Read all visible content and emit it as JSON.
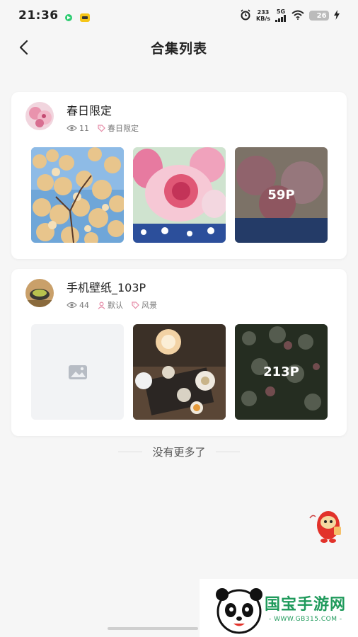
{
  "status_bar": {
    "time": "21:36",
    "net_speed_value": "233",
    "net_speed_unit": "KB/s",
    "network": "5G",
    "battery": "26",
    "battery_level_percent": 26
  },
  "nav": {
    "title": "合集列表"
  },
  "collections": [
    {
      "title": "春日限定",
      "views": "11",
      "tag": "春日限定",
      "more_count": "59P"
    },
    {
      "title": "手机壁纸_103P",
      "views": "44",
      "author": "默认",
      "tag": "风景",
      "more_count": "213P"
    }
  ],
  "footer": {
    "no_more": "没有更多了"
  },
  "watermark": {
    "name": "国宝手游网",
    "url": "- WWW.GB315.COM -"
  },
  "colors": {
    "accent_pink": "#e58aa6",
    "watermark_green": "#1f9a5b",
    "background": "#f6f6f6"
  }
}
